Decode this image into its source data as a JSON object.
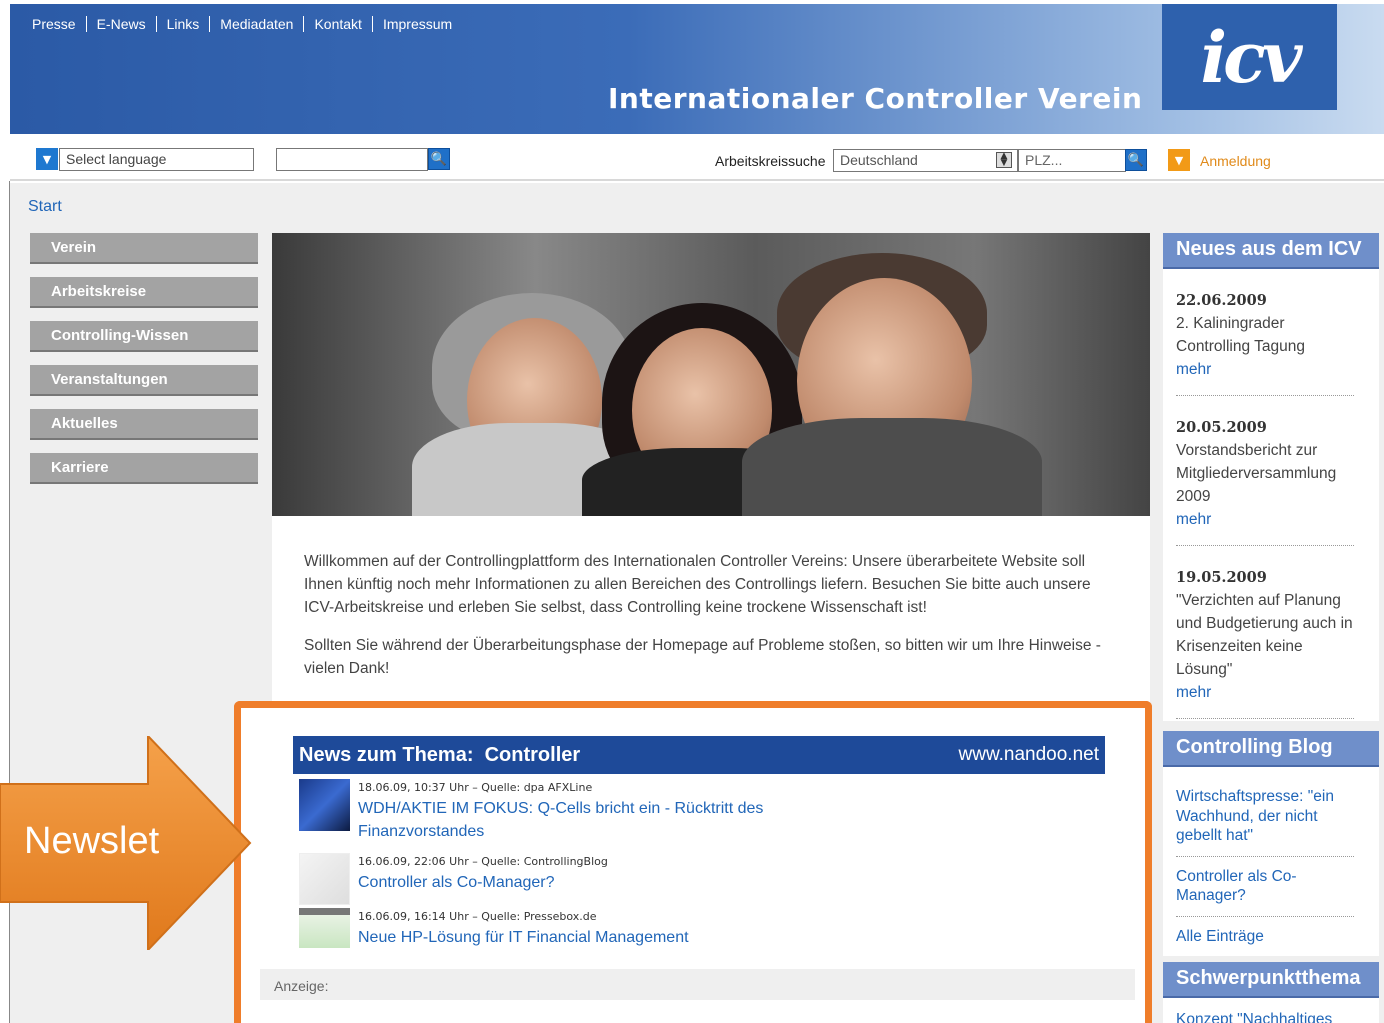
{
  "header": {
    "nav": [
      "Presse",
      "E-News",
      "Links",
      "Mediadaten",
      "Kontakt",
      "Impressum"
    ],
    "site_title": "Internationaler Controller Verein",
    "logo_text": "icv"
  },
  "toolbar": {
    "language_select": "Select language",
    "search_value": "",
    "arbeitskreis_label": "Arbeitskreissuche",
    "country_select": "Deutschland",
    "plz_placeholder": "PLZ...",
    "login_label": "Anmeldung"
  },
  "breadcrumb": "Start",
  "left_nav": [
    "Verein",
    "Arbeitskreise",
    "Controlling-Wissen",
    "Veranstaltungen",
    "Aktuelles",
    "Karriere"
  ],
  "welcome": {
    "p1": "Willkommen auf der Controllingplattform des Internationalen Controller Vereins: Unsere überarbeitete Website soll Ihnen künftig noch mehr Informationen zu allen Bereichen des Controllings liefern. Besuchen Sie bitte auch unsere ICV-Arbeitskreise und erleben Sie selbst, dass Controlling keine trockene Wissenschaft ist!",
    "p2": "Sollten Sie während der Überarbeitungsphase der Homepage auf Probleme stoßen, so bitten wir um Ihre Hinweise - vielen Dank!"
  },
  "news_widget": {
    "title": "News zum Thema:",
    "topic": "Controller",
    "source_url": "www.nandoo.net",
    "items": [
      {
        "meta": "18.06.09, 10:37 Uhr – Quelle: dpa AFXLine",
        "title": "WDH/AKTIE IM FOKUS: Q-Cells bricht ein - Rücktritt des Finanzvorstandes"
      },
      {
        "meta": "16.06.09, 22:06 Uhr – Quelle: ControllingBlog",
        "title": "Controller als Co-Manager?"
      },
      {
        "meta": "16.06.09, 16:14 Uhr – Quelle: Pressebox.de",
        "title": "Neue HP-Lösung für IT Financial Management"
      }
    ],
    "ad_label": "Anzeige:"
  },
  "sidebar": {
    "news_heading": "Neues aus dem ICV",
    "news": [
      {
        "date": "22.06.2009",
        "text": "2. Kaliningrader Controlling Tagung",
        "more": "mehr"
      },
      {
        "date": "20.05.2009",
        "text": "Vorstandsbericht zur Mitgliederversammlung 2009",
        "more": "mehr"
      },
      {
        "date": "19.05.2009",
        "text": "\"Verzichten auf Planung und Budgetierung auch in Krisenzeiten keine Lösung\"",
        "more": "mehr"
      }
    ],
    "blog_heading": "Controlling Blog",
    "blog_links": [
      "Wirtschaftspresse: \"ein Wachhund, der nicht gebellt hat\"",
      "Controller als Co-Manager?",
      "Alle Einträge"
    ],
    "focus_heading": "Schwerpunktthema",
    "focus_link": "Konzept \"Nachhaltiges"
  },
  "annotation": {
    "arrow_label": "Newslet",
    "arrow_color": "#ef8a1e",
    "frame_color": "#ef7d2a"
  }
}
